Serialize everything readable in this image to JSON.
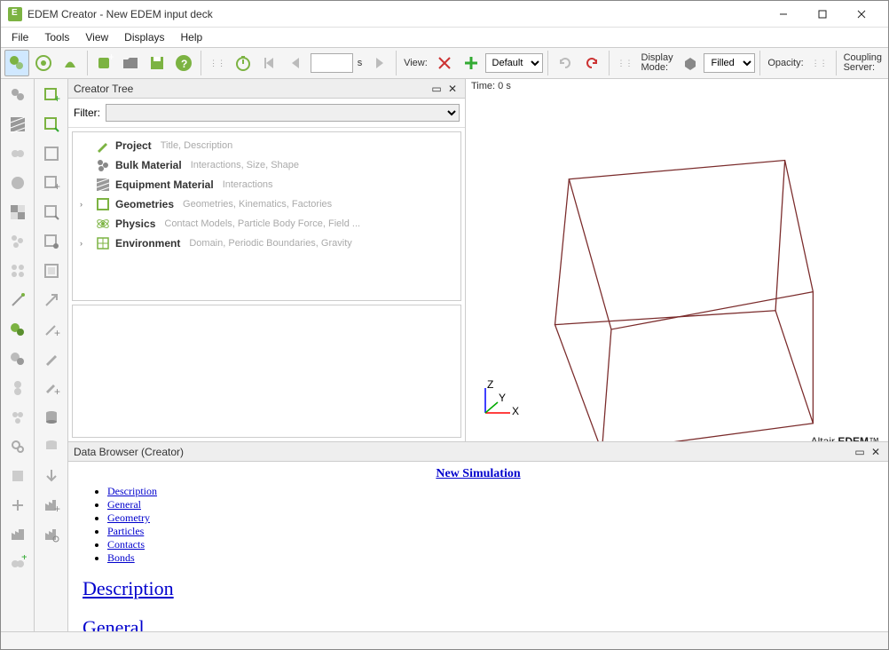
{
  "window": {
    "title": "EDEM Creator - New EDEM input deck"
  },
  "menu": {
    "items": [
      "File",
      "Tools",
      "View",
      "Displays",
      "Help"
    ]
  },
  "toolbar": {
    "time_unit": "s",
    "view_label": "View:",
    "view_select": "Default",
    "display_mode_label": "Display\nMode:",
    "display_mode_value": "Filled",
    "opacity_label": "Opacity:",
    "coupling_label": "Coupling\nServer:"
  },
  "creator": {
    "panel_title": "Creator Tree",
    "filter_label": "Filter:",
    "tree": [
      {
        "icon": "pencil",
        "label": "Project",
        "desc": "Title, Description",
        "expand": ""
      },
      {
        "icon": "bulk",
        "label": "Bulk Material",
        "desc": "Interactions, Size, Shape",
        "expand": ""
      },
      {
        "icon": "equip",
        "label": "Equipment Material",
        "desc": "Interactions",
        "expand": ""
      },
      {
        "icon": "geom",
        "label": "Geometries",
        "desc": "Geometries, Kinematics, Factories",
        "expand": "›"
      },
      {
        "icon": "physics",
        "label": "Physics",
        "desc": "Contact Models, Particle Body Force, Field ...",
        "expand": ""
      },
      {
        "icon": "env",
        "label": "Environment",
        "desc": "Domain, Periodic Boundaries, Gravity",
        "expand": "›"
      }
    ]
  },
  "viewport": {
    "time_label": "Time: 0 s",
    "brand_prefix": "Altair ",
    "brand_bold": "EDEM",
    "brand_tm": "™",
    "axes": {
      "x": "X",
      "y": "Y",
      "z": "Z"
    }
  },
  "data_browser": {
    "panel_title": "Data Browser (Creator)",
    "title": "New Simulation",
    "links": [
      "Description",
      "General",
      "Geometry",
      "Particles",
      "Contacts",
      "Bonds"
    ],
    "heading1": "Description",
    "heading2": "General"
  }
}
